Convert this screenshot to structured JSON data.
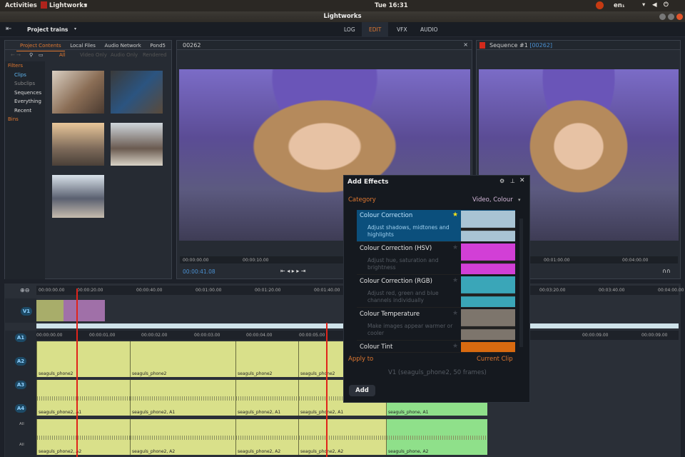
{
  "system": {
    "activities": "Activities",
    "app_menu": "Lightworks",
    "clock": "Tue 16:31",
    "lang": "en₁"
  },
  "window": {
    "title": "Lightworks"
  },
  "toolbar": {
    "project": "Project trains",
    "tabs": [
      "LOG",
      "EDIT",
      "VFX",
      "AUDIO"
    ],
    "active_tab": "EDIT"
  },
  "browser": {
    "tabs": [
      "Project Contents",
      "Local Files",
      "Audio Network",
      "Pond5"
    ],
    "filters": [
      "All",
      "Video Only",
      "Audio Only",
      "Rendered"
    ],
    "filters_label": "Filters",
    "bins_label": "Bins",
    "items": [
      "Clips",
      "Subclips",
      "Sequences",
      "Everything",
      "Recent"
    ]
  },
  "viewer1": {
    "title": "00262",
    "timecodes": [
      "00:00:00.00",
      "00:00:10.00"
    ],
    "current": "00:00:41.08"
  },
  "viewer2": {
    "title": "Sequence #1",
    "id": "[00262]",
    "timecodes": [
      "00:01:00.00",
      "00:04:00.00"
    ]
  },
  "timeline": {
    "ruler": [
      "00:00:00.00",
      "00:00:20.00",
      "00:00:40.00",
      "00:01:00.00",
      "00:01:20.00",
      "00:01:40.00",
      "00:03:20.00",
      "00:03:40.00",
      "00:04:00.00"
    ],
    "sub_ruler": [
      "00:00:00.00",
      "00:00:01.00",
      "00:00:02.00",
      "00:00:03.00",
      "00:00:04.00",
      "00:00:05.00",
      "00:00:09.00",
      "00:00:09.00"
    ],
    "tracks": [
      "V1",
      "A1",
      "A2",
      "A3",
      "A4",
      "All",
      "All"
    ],
    "v_clips": [
      "seaguls_phone2",
      "seaguls_phone2",
      "seaguls_phone2",
      "seaguls_phone2"
    ],
    "a1_clips": [
      "seaguls_phone2, A1",
      "seaguls_phone2, A1",
      "seaguls_phone2, A1",
      "seaguls_phone2, A1",
      "seaguls_phone, A1"
    ],
    "a2_clips": [
      "seaguls_phone2, A2",
      "seaguls_phone2, A2",
      "seaguls_phone2, A2",
      "seaguls_phone2, A2",
      "seaguls_phone, A2"
    ]
  },
  "dialog": {
    "title": "Add Effects",
    "category_label": "Category",
    "category_value": "Video, Colour",
    "effects": [
      {
        "name": "Colour Correction",
        "desc": "Adjust shadows, midtones and highlights",
        "color": "#a9c4d4"
      },
      {
        "name": "Colour Correction (HSV)",
        "desc": "Adjust hue, saturation and brightness",
        "color": "#d23fd6"
      },
      {
        "name": "Colour Correction (RGB)",
        "desc": "Adjust red, green and blue channels individually",
        "color": "#3aa6b8"
      },
      {
        "name": "Colour Temperature",
        "desc": "Make images appear warmer or cooler",
        "color": "#7d756c"
      },
      {
        "name": "Colour Tint",
        "desc": "",
        "color": "#d86a10"
      }
    ],
    "apply_label": "Apply to",
    "apply_value": "Current Clip",
    "target": "V1 (seaguls_phone2, 50 frames)",
    "add": "Add"
  }
}
